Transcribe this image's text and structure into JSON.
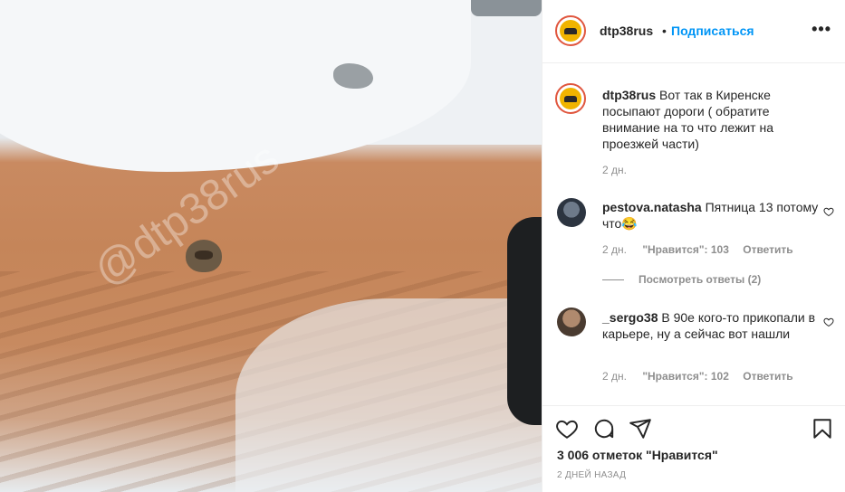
{
  "post": {
    "username": "dtp38rus",
    "separator": "•",
    "follow_label": "Подписаться",
    "more_label": "•••",
    "photo_watermark": "@dtp38rus"
  },
  "caption": {
    "username": "dtp38rus",
    "text": "Вот так в Киренске посыпают дороги ( обратите внимание на то что лежит на проезжей части)",
    "time": "2 дн."
  },
  "comments": [
    {
      "username": "pestova.natasha",
      "text": "Пятница 13 потому что😂",
      "time": "2 дн.",
      "likes": "\"Нравится\": 103",
      "reply_label": "Ответить"
    },
    {
      "username": "_sergo38",
      "text": "В 90е кого-то прикопали в карьере, ну а сейчас вот нашли",
      "time": "2 дн.",
      "likes": "\"Нравится\": 102",
      "reply_label": "Ответить"
    }
  ],
  "view_replies": "Посмотреть ответы (2)",
  "footer": {
    "likes": "3 006 отметок \"Нравится\"",
    "posted_ago": "2 ДНЕЙ НАЗАД"
  },
  "icons": {
    "like": "heart-icon",
    "comment": "comment-icon",
    "share": "share-icon",
    "save": "bookmark-icon",
    "more": "more-options-icon"
  },
  "colors": {
    "accent": "#0095f6",
    "muted": "#8e8e8e",
    "text": "#262626",
    "border": "#efefef"
  }
}
